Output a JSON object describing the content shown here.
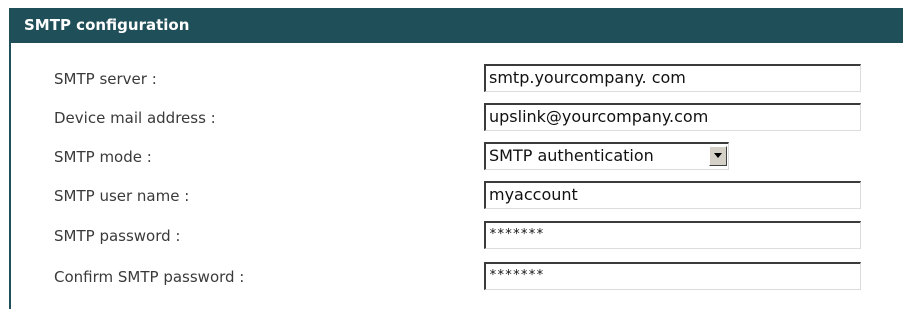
{
  "header": {
    "title": "SMTP configuration"
  },
  "rows": [
    {
      "label": "SMTP server :",
      "value": "smtp.yourcompany. com"
    },
    {
      "label": "Device mail address :",
      "value": "upslink@yourcompany.com"
    },
    {
      "label": "SMTP mode :",
      "value": "SMTP authentication"
    },
    {
      "label": "SMTP user name :",
      "value": "myaccount"
    },
    {
      "label": "SMTP password :",
      "value": "*******"
    },
    {
      "label": "Confirm SMTP password :",
      "value": "*******"
    }
  ],
  "colors": {
    "header_bg": "#1f4f58",
    "header_text": "#ffffff",
    "label_text": "#3a3a3a"
  },
  "icons": {
    "dropdown": "chevron-down-icon"
  }
}
